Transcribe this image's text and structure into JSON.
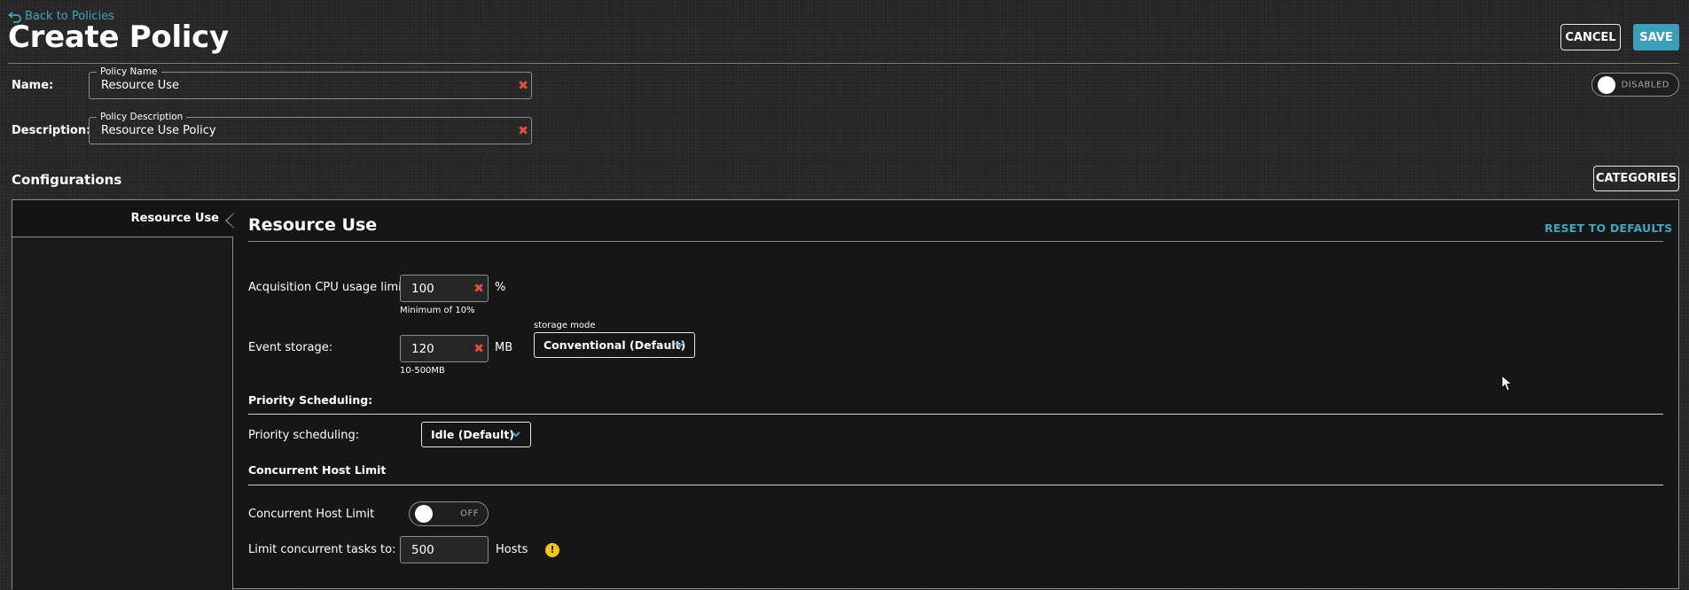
{
  "header": {
    "back_label": "Back to Policies",
    "title": "Create Policy",
    "cancel_label": "CANCEL",
    "save_label": "SAVE",
    "status_toggle": "DISABLED"
  },
  "form": {
    "name_label": "Name:",
    "name_legend": "Policy Name",
    "name_value": "Resource Use",
    "description_label": "Description:",
    "description_legend": "Policy Description",
    "description_value": "Resource Use Policy"
  },
  "configurations": {
    "title": "Configurations",
    "categories_label": "CATEGORIES",
    "nav_items": [
      "Resource Use"
    ]
  },
  "resource_use": {
    "title": "Resource Use",
    "reset_label": "RESET TO DEFAULTS",
    "cpu_label": "Acquisition CPU usage limit",
    "cpu_value": "100",
    "cpu_unit": "%",
    "cpu_hint": "Minimum of 10%",
    "event_label": "Event storage:",
    "event_value": "120",
    "event_unit": "MB",
    "event_hint": "10-500MB",
    "storage_mode_label": "storage mode",
    "storage_mode_value": "Conventional (Default)",
    "priority_heading": "Priority Scheduling:",
    "priority_label": "Priority scheduling:",
    "priority_value": "Idle (Default)",
    "concurrent_heading": "Concurrent Host Limit",
    "concurrent_label": "Concurrent Host Limit",
    "concurrent_toggle": "OFF",
    "limit_label": "Limit concurrent tasks to:",
    "limit_value": "500",
    "limit_unit": "Hosts",
    "warn_symbol": "!"
  },
  "colors": {
    "accent": "#3a9fb8",
    "link": "#3ea7c0",
    "clear": "#e74c3c",
    "warning": "#f2c811"
  },
  "icons": [
    "back-arrow-icon",
    "clear-icon",
    "chevron-down-icon",
    "warning-icon",
    "mouse-cursor-icon"
  ]
}
